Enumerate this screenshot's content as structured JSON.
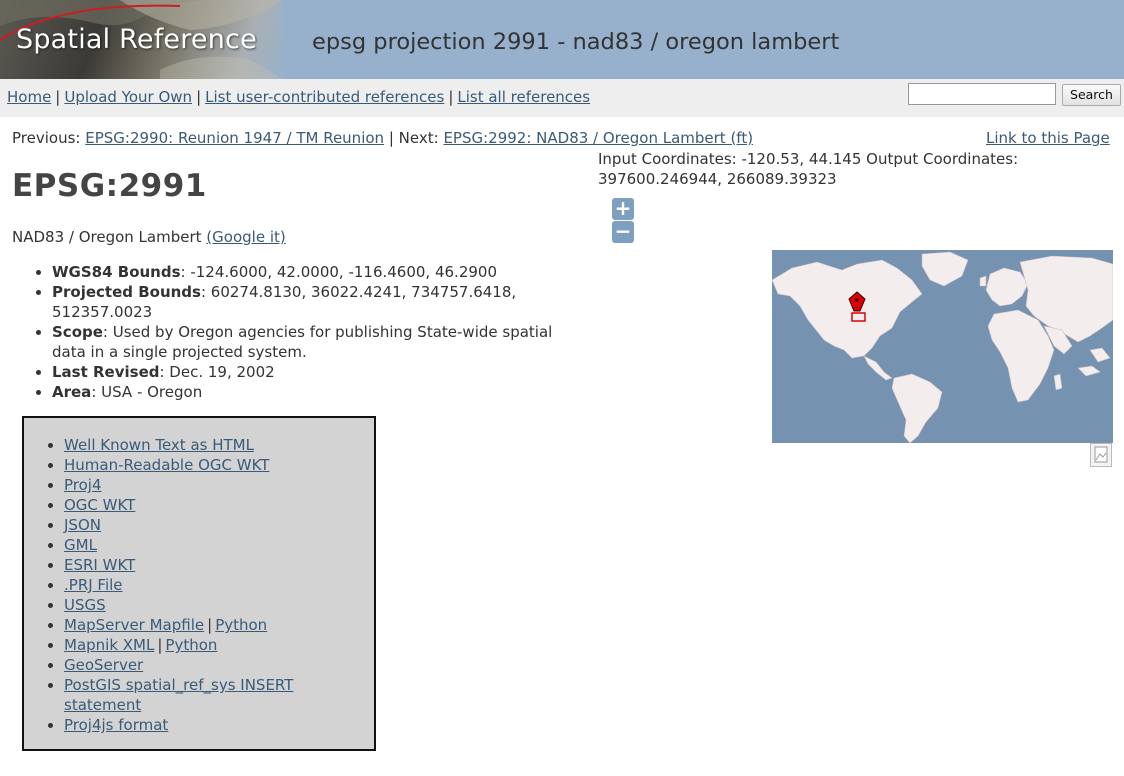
{
  "header": {
    "logo_text": "Spatial Reference",
    "page_heading": "epsg projection 2991 - nad83 / oregon lambert",
    "colors": {
      "banner": "#97b1cd",
      "link": "#3a5a78"
    }
  },
  "nav": {
    "links": [
      "Home",
      "Upload Your Own",
      "List user-contributed references",
      "List all references"
    ],
    "separator": "|",
    "search": {
      "value": "",
      "placeholder": "",
      "button_label": "Search"
    }
  },
  "prevnext": {
    "previous_label": "Previous:",
    "previous_link": "EPSG:2990: Reunion 1947 / TM Reunion",
    "separator": "|",
    "next_label": "Next:",
    "next_link": "EPSG:2992: NAD83 / Oregon Lambert (ft)",
    "permalink": "Link to this Page"
  },
  "coordinates": {
    "text": "Input Coordinates: -120.53, 44.145 Output Coordinates: 397600.246944, 266089.39323"
  },
  "reference": {
    "title": "EPSG:2991",
    "name": "NAD83 / Oregon Lambert",
    "google_link": "(Google it)",
    "details": [
      {
        "label": "WGS84 Bounds",
        "value": ": -124.6000, 42.0000, -116.4600, 46.2900"
      },
      {
        "label": "Projected Bounds",
        "value": ": 60274.8130, 36022.4241, 734757.6418, 512357.0023"
      },
      {
        "label": "Scope",
        "value": ": Used by Oregon agencies for publishing State-wide spatial data in a single projected system."
      },
      {
        "label": "Last Revised",
        "value": ": Dec. 19, 2002"
      },
      {
        "label": "Area",
        "value": ": USA - Oregon"
      }
    ]
  },
  "formats": {
    "items": [
      "Well Known Text as HTML",
      "Human-Readable OGC WKT",
      "Proj4",
      "OGC WKT",
      "JSON",
      "GML",
      "ESRI WKT",
      ".PRJ File",
      "USGS",
      "MapServer Mapfile",
      "Mapnik XML",
      "GeoServer",
      "PostGIS spatial_ref_sys INSERT statement",
      "Proj4js format"
    ],
    "python_label": "Python",
    "pipe": "|"
  },
  "map": {
    "zoom_in": "+",
    "zoom_out": "−",
    "icons": [
      "zoom-in-icon",
      "zoom-out-icon",
      "location-marker-icon",
      "layer-switcher-icon"
    ],
    "colors": {
      "ocean": "#7592b1",
      "land": "#f3eded",
      "marker": "#dd0000"
    }
  }
}
